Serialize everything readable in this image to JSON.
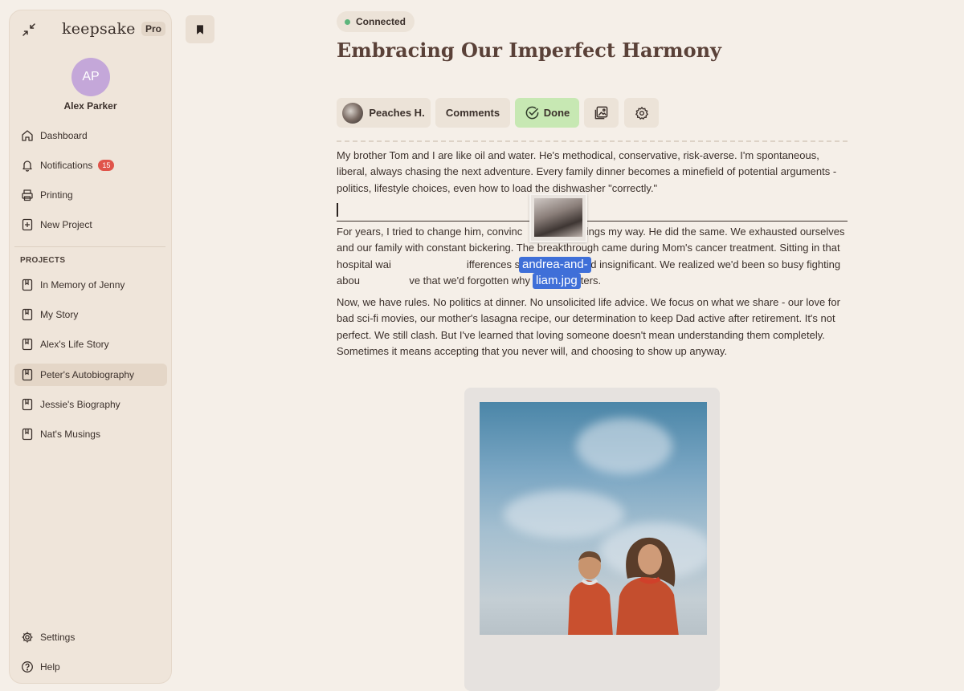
{
  "sidebar": {
    "brand": "keepsake",
    "plan_badge": "Pro",
    "user": {
      "initials": "AP",
      "name": "Alex Parker"
    },
    "nav": [
      {
        "label": "Dashboard",
        "icon": "home-icon"
      },
      {
        "label": "Notifications",
        "icon": "bell-icon",
        "badge": "15"
      },
      {
        "label": "Printing",
        "icon": "printer-icon"
      },
      {
        "label": "New Project",
        "icon": "plus-square-icon"
      }
    ],
    "projects_heading": "PROJECTS",
    "projects": [
      {
        "label": "In Memory of Jenny"
      },
      {
        "label": "My Story"
      },
      {
        "label": "Alex's Life Story"
      },
      {
        "label": "Peter's Autobiography",
        "active": true
      },
      {
        "label": "Jessie's Biography"
      },
      {
        "label": "Nat's Musings"
      }
    ],
    "footer": [
      {
        "label": "Settings",
        "icon": "gear-icon"
      },
      {
        "label": "Help",
        "icon": "help-icon"
      }
    ]
  },
  "main": {
    "status": "Connected",
    "title": "Embracing Our Imperfect Harmony",
    "toolbar": {
      "author": "Peaches H.",
      "comments": "Comments",
      "done": "Done"
    },
    "paragraphs": [
      "My brother Tom and I are like oil and water. He's methodical, conservative, risk-averse. I'm spontaneous, liberal, always chasing the next adventure. Every family dinner becomes a minefield of potential arguments - politics, lifestyle choices, even how to load the dishwasher \"correctly.\"",
      "For years, I tried to change him, convinc                e things my way. He did the same. We exhausted ourselves and our family with constant bickering. The breakthrough came during Mom's cancer treatment. Sitting in that hospital wai                          ifferences suddenly seemed insignificant. We realized we'd been so busy fighting abou                 ve that we'd forgotten why family matters.",
      "Now, we have rules. No politics at dinner. No unsolicited life advice. We focus on what we share - our love for bad sci-fi movies, our mother's lasagna recipe, our determination to keep Dad active after retirement. It's not perfect. We still clash. But I've learned that loving someone doesn't mean understanding them completely. Sometimes it means accepting that you never will, and choosing to show up anyway."
    ],
    "drag_file": {
      "line1": "andrea-and-",
      "line2": "liam.jpg"
    }
  }
}
